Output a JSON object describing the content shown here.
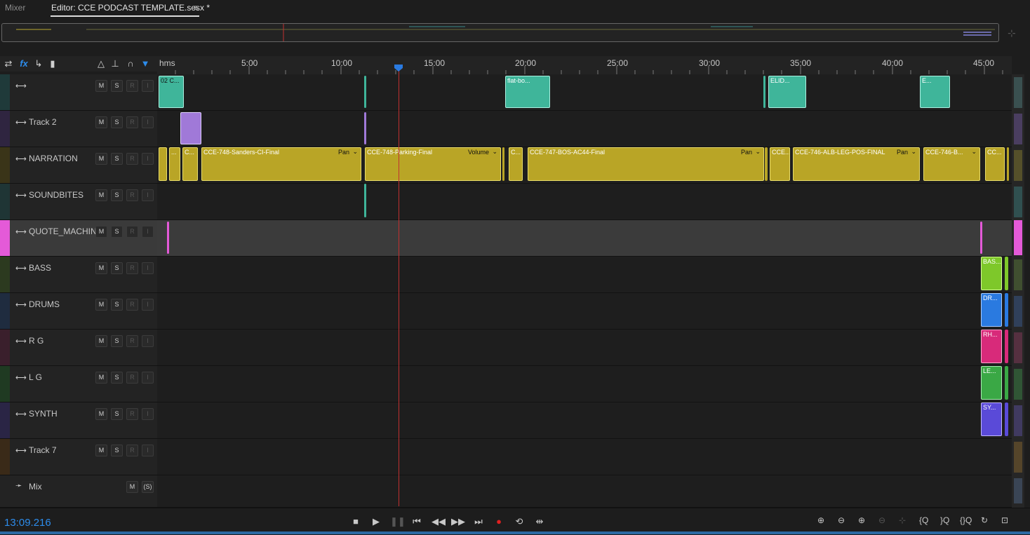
{
  "tabs": [
    {
      "label": "Mixer"
    },
    {
      "label": "Editor: CCE PODCAST TEMPLATE.sesx *"
    }
  ],
  "tab_menu_icon": "≡",
  "ruler": {
    "unit": "hms",
    "labels": [
      "5:00",
      "10:00",
      "15:00",
      "20:00",
      "25:00",
      "30:00",
      "35:00",
      "40:00",
      "45:00"
    ]
  },
  "tracks": [
    {
      "name": "",
      "color": "#1f3a3a",
      "buttons": [
        "M",
        "S",
        "R",
        "I"
      ]
    },
    {
      "name": "Track 2",
      "color": "#2f2540",
      "buttons": [
        "M",
        "S",
        "R",
        "I"
      ]
    },
    {
      "name": "NARRATION",
      "color": "#3a3418",
      "buttons": [
        "M",
        "S",
        "R",
        "I"
      ]
    },
    {
      "name": "SOUNDBITES",
      "color": "#1f3535",
      "buttons": [
        "M",
        "S",
        "R",
        "I"
      ]
    },
    {
      "name": "QUOTE_MACHIN",
      "color": "#e45ad8",
      "buttons": [
        "M",
        "S",
        "R",
        "I"
      ]
    },
    {
      "name": "BASS",
      "color": "#2c3a1f",
      "buttons": [
        "M",
        "S",
        "R",
        "I"
      ]
    },
    {
      "name": "DRUMS",
      "color": "#1f2c3f",
      "buttons": [
        "M",
        "S",
        "R",
        "I"
      ]
    },
    {
      "name": "R G",
      "color": "#3a1f2c",
      "buttons": [
        "M",
        "S",
        "R",
        "I"
      ]
    },
    {
      "name": "L G",
      "color": "#1f3a22",
      "buttons": [
        "M",
        "S",
        "R",
        "I"
      ]
    },
    {
      "name": "SYNTH",
      "color": "#2a2545",
      "buttons": [
        "M",
        "S",
        "R",
        "I"
      ]
    },
    {
      "name": "Track 7",
      "color": "#3a2a18",
      "buttons": [
        "M",
        "S",
        "R",
        "I"
      ]
    }
  ],
  "mix": {
    "name": "Mix",
    "buttons": [
      "M",
      "(S)"
    ]
  },
  "clips": {
    "t1": [
      "02 C...",
      "flat-bo...",
      "ELID...",
      "E..."
    ],
    "narration": [
      "...",
      "C...",
      "CCE-748-Sanders-CI-Final",
      "CCE-748-Parking-Final",
      "C...",
      "CCE-747-BOS-AC44-Final",
      "CCE...",
      "CCE-746-ALB-LEG-POS-FINAL",
      "CCE-746-B...",
      "CC..."
    ],
    "narration_effects": [
      "Pan",
      "Volume",
      "Pan",
      "Pan"
    ],
    "stems": [
      "BAS...",
      "DR...",
      "RH...",
      "LE...",
      "SY..."
    ]
  },
  "transport": {
    "timecode": "13:09.216"
  }
}
